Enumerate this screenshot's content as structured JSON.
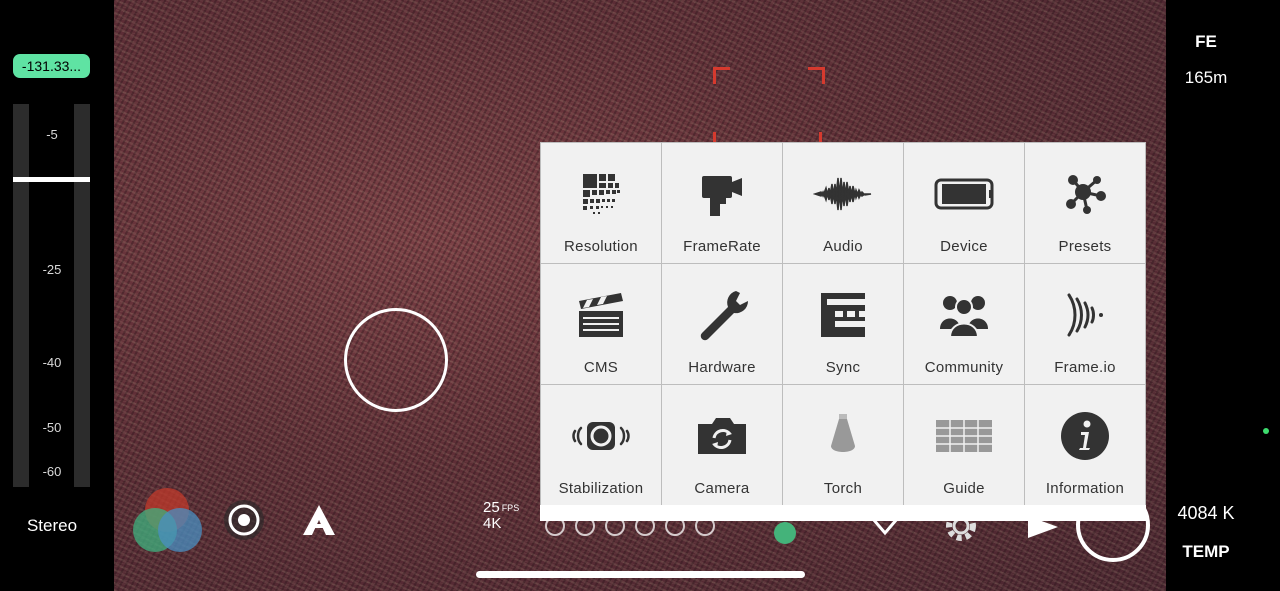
{
  "audio": {
    "level_readout": "-131.33...",
    "scale": [
      "-5",
      "-25",
      "-40",
      "-50",
      "-60"
    ],
    "channel_mode": "Stereo"
  },
  "right_panel": {
    "exposure_mode": "FE",
    "focus_distance": "165m",
    "white_balance": "4084 K",
    "white_balance_mode": "TEMP"
  },
  "recording": {
    "fps": "25",
    "fps_unit": "FPS",
    "resolution": "4K"
  },
  "menu": {
    "items": [
      {
        "label": "Resolution",
        "icon": "resolution-icon"
      },
      {
        "label": "FrameRate",
        "icon": "movie-camera-icon"
      },
      {
        "label": "Audio",
        "icon": "waveform-icon"
      },
      {
        "label": "Device",
        "icon": "phone-icon"
      },
      {
        "label": "Presets",
        "icon": "molecule-icon"
      },
      {
        "label": "CMS",
        "icon": "clapperboard-icon"
      },
      {
        "label": "Hardware",
        "icon": "wrench-icon"
      },
      {
        "label": "Sync",
        "icon": "sync-icon"
      },
      {
        "label": "Community",
        "icon": "people-icon"
      },
      {
        "label": "Frame.io",
        "icon": "signal-waves-icon"
      },
      {
        "label": "Stabilization",
        "icon": "stabilization-icon"
      },
      {
        "label": "Camera",
        "icon": "camera-rotate-icon"
      },
      {
        "label": "Torch",
        "icon": "torch-icon"
      },
      {
        "label": "Guide",
        "icon": "grid-guide-icon"
      },
      {
        "label": "Information",
        "icon": "info-icon"
      }
    ]
  },
  "colors": {
    "accent_green": "#5fe3a3",
    "focus_red": "#d63a2e",
    "tile_bg": "#f1f1f1",
    "icon_dark": "#333333"
  }
}
